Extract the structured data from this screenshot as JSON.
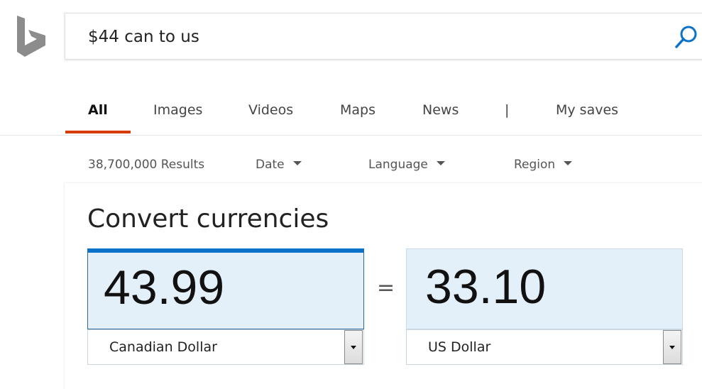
{
  "search": {
    "query": "$44 can to us"
  },
  "tabs": [
    {
      "label": "All",
      "active": true
    },
    {
      "label": "Images",
      "active": false
    },
    {
      "label": "Videos",
      "active": false
    },
    {
      "label": "Maps",
      "active": false
    },
    {
      "label": "News",
      "active": false
    },
    {
      "label": "|",
      "active": false
    },
    {
      "label": "My saves",
      "active": false
    }
  ],
  "filters": {
    "results": "38,700,000 Results",
    "date": "Date",
    "language": "Language",
    "region": "Region"
  },
  "converter": {
    "title": "Convert currencies",
    "from_amount": "43.99",
    "equals": "=",
    "to_amount": "33.10",
    "from_currency": "Canadian Dollar",
    "to_currency": "US Dollar"
  },
  "colors": {
    "accent_tab": "#d83b01",
    "input_focus": "#0a72c8",
    "amount_bg": "#e4f0f9",
    "search_icon": "#0a72c8",
    "logo": "#8c8c8c"
  },
  "icons": {
    "logo": "bing-logo-icon",
    "search": "search-icon",
    "dropdown": "chevron-down-icon"
  }
}
